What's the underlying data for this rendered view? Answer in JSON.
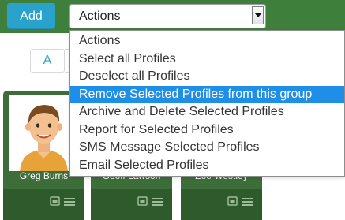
{
  "toolbar": {
    "add_label": "Add",
    "select_value": "Actions"
  },
  "filter": {
    "letter": "A"
  },
  "dropdown": {
    "options": [
      "Actions",
      "Select all Profiles",
      "Deselect all Profiles",
      "Remove Selected Profiles from this group",
      "Archive and Delete Selected Profiles",
      "Report for Selected Profiles",
      "SMS Message Selected Profiles",
      "Email Selected Profiles"
    ],
    "highlighted_index": 3
  },
  "profiles": [
    {
      "name": "Greg Burns"
    },
    {
      "name": "Geoff Lawson"
    },
    {
      "name": "Zoe Westley"
    }
  ],
  "colors": {
    "topbar": "#3f7f3c",
    "add_button": "#2aa3cc",
    "highlight": "#1f8ee6",
    "card": "#3d6e39"
  }
}
